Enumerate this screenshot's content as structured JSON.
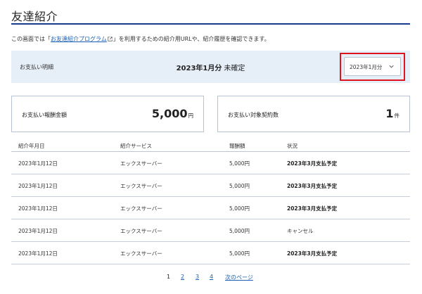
{
  "page": {
    "title": "友達紹介"
  },
  "intro": {
    "before": "この画面では「",
    "link": "お友達紹介プログラム",
    "after": "」を利用するための紹介用URLや、紹介履歴を確認できます。"
  },
  "payment_banner": {
    "label": "お支払い明細",
    "month": "2023年1月分",
    "status": "未確定",
    "month_select": {
      "value": "2023年1月分"
    }
  },
  "cards": [
    {
      "label": "お支払い報酬金額",
      "value": "5,000",
      "unit": "円"
    },
    {
      "label": "お支払い対象契約数",
      "value": "1",
      "unit": "件"
    }
  ],
  "table": {
    "headers": [
      "紹介年月日",
      "紹介サービス",
      "報酬額",
      "状況"
    ],
    "rows": [
      {
        "date": "2023年1月12日",
        "service": "エックスサーバー",
        "amount": "5,000円",
        "status": "2023年3月支払予定"
      },
      {
        "date": "2023年1月12日",
        "service": "エックスサーバー",
        "amount": "5,000円",
        "status": "2023年3月支払予定"
      },
      {
        "date": "2023年1月12日",
        "service": "エックスサーバー",
        "amount": "5,000円",
        "status": "2023年3月支払予定"
      },
      {
        "date": "2023年1月12日",
        "service": "エックスサーバー",
        "amount": "5,000円",
        "status": "キャンセル"
      },
      {
        "date": "2023年1月12日",
        "service": "エックスサーバー",
        "amount": "5,000円",
        "status": "2023年3月支払予定"
      }
    ]
  },
  "pager": {
    "pages": [
      "1",
      "2",
      "3",
      "4"
    ],
    "current": "1",
    "next_label": "次のページ"
  },
  "colors": {
    "accent_rule": "#1a3a8c",
    "banner_bg": "#e6eef8",
    "highlight_frame": "#e0141e",
    "link": "#1a5fb4"
  }
}
